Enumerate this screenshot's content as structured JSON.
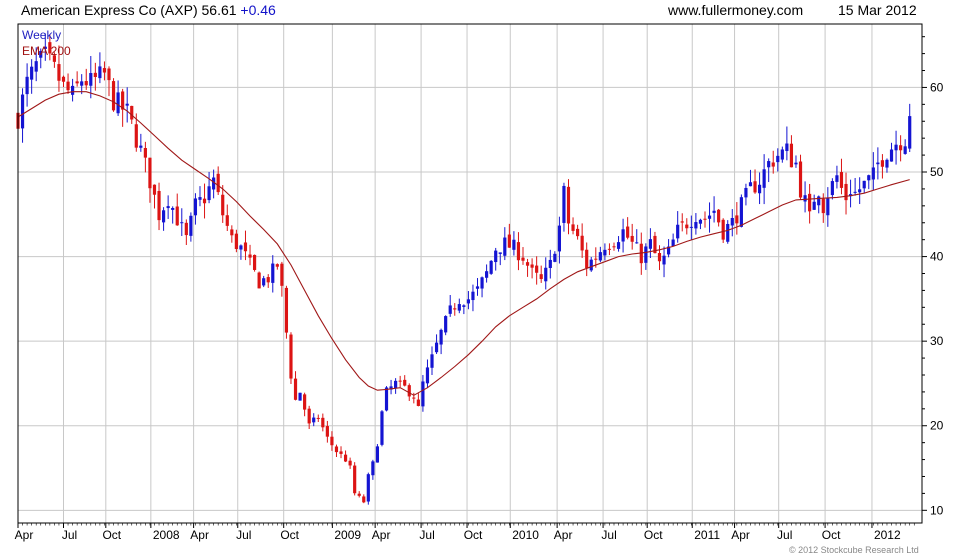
{
  "header": {
    "title": "American Express Co (AXP) 56.61",
    "change": "+0.46",
    "site": "www.fullermoney.com",
    "date": "15 Mar 2012"
  },
  "legend": {
    "weekly": "Weekly",
    "ema": "EMA 200"
  },
  "copyright": "© 2012 Stockcube Research Ltd",
  "colors": {
    "up": "#1414d2",
    "down": "#dc1414",
    "ema": "#a01818",
    "grid": "#c8c8c8",
    "axis": "#000000"
  },
  "chart_data": {
    "type": "candlestick",
    "ylim": [
      8.5,
      67.5
    ],
    "xlim": [
      0,
      198.7
    ],
    "y_ticks": [
      10,
      20,
      30,
      40,
      50,
      60
    ],
    "x_ticks": [
      {
        "label": "Apr",
        "x": 0
      },
      {
        "label": "Jul",
        "x": 10
      },
      {
        "label": "Oct",
        "x": 19.3
      },
      {
        "label": "2008",
        "x": 29.2
      },
      {
        "label": "Apr",
        "x": 38.6
      },
      {
        "label": "Jul",
        "x": 48.3
      },
      {
        "label": "Oct",
        "x": 58.4
      },
      {
        "label": "2009",
        "x": 69.1
      },
      {
        "label": "Apr",
        "x": 78.5
      },
      {
        "label": "Jul",
        "x": 88.6
      },
      {
        "label": "Oct",
        "x": 98.7
      },
      {
        "label": "2010",
        "x": 108.2
      },
      {
        "label": "Apr",
        "x": 118.5
      },
      {
        "label": "Jul",
        "x": 128.6
      },
      {
        "label": "Oct",
        "x": 138.3
      },
      {
        "label": "2011",
        "x": 148.2
      },
      {
        "label": "Apr",
        "x": 157.5
      },
      {
        "label": "Jul",
        "x": 167.2
      },
      {
        "label": "Oct",
        "x": 177.4
      },
      {
        "label": "2012",
        "x": 187.7
      }
    ],
    "close_anchors": [
      [
        0,
        56.5
      ],
      [
        2,
        60.5
      ],
      [
        4,
        62.5
      ],
      [
        6,
        63.5
      ],
      [
        8,
        62
      ],
      [
        10,
        60
      ],
      [
        12,
        59
      ],
      [
        14,
        61
      ],
      [
        16,
        60.5
      ],
      [
        19,
        61.5
      ],
      [
        21,
        58.5
      ],
      [
        24,
        57
      ],
      [
        27,
        52.5
      ],
      [
        29,
        49
      ],
      [
        31,
        45
      ],
      [
        33,
        47
      ],
      [
        35,
        44.5
      ],
      [
        37,
        42
      ],
      [
        39,
        46
      ],
      [
        41,
        47
      ],
      [
        43,
        49
      ],
      [
        45,
        45
      ],
      [
        47,
        42
      ],
      [
        49,
        41
      ],
      [
        51,
        39
      ],
      [
        53,
        37
      ],
      [
        55,
        37.5
      ],
      [
        57,
        39
      ],
      [
        58,
        36
      ],
      [
        59,
        31
      ],
      [
        60,
        26
      ],
      [
        61,
        23
      ],
      [
        62,
        24
      ],
      [
        64,
        20
      ],
      [
        66,
        21
      ],
      [
        68,
        18.5
      ],
      [
        70,
        17
      ],
      [
        72,
        16
      ],
      [
        73,
        15
      ],
      [
        74,
        12
      ],
      [
        75,
        11.5
      ],
      [
        76,
        11
      ],
      [
        77,
        14
      ],
      [
        78,
        15.5
      ],
      [
        79,
        18
      ],
      [
        80,
        21.5
      ],
      [
        81,
        24
      ],
      [
        83,
        25
      ],
      [
        85,
        24.5
      ],
      [
        87,
        23.5
      ],
      [
        88,
        22
      ],
      [
        89,
        25
      ],
      [
        91,
        28
      ],
      [
        93,
        31
      ],
      [
        95,
        33.5
      ],
      [
        97,
        35
      ],
      [
        99,
        35
      ],
      [
        101,
        36
      ],
      [
        103,
        38
      ],
      [
        105,
        41
      ],
      [
        107,
        41.5
      ],
      [
        109,
        41
      ],
      [
        111,
        40
      ],
      [
        113,
        38
      ],
      [
        115,
        37
      ],
      [
        117,
        39
      ],
      [
        119,
        43.5
      ],
      [
        120,
        47.5
      ],
      [
        121,
        44
      ],
      [
        123,
        42
      ],
      [
        125,
        39
      ],
      [
        127,
        40
      ],
      [
        129,
        41.5
      ],
      [
        131,
        42
      ],
      [
        133,
        43
      ],
      [
        135,
        41.5
      ],
      [
        137,
        40
      ],
      [
        139,
        41.5
      ],
      [
        141,
        39
      ],
      [
        143,
        40.5
      ],
      [
        145,
        43
      ],
      [
        147,
        44
      ],
      [
        149,
        45
      ],
      [
        151,
        44.5
      ],
      [
        153,
        45.5
      ],
      [
        155,
        43
      ],
      [
        157,
        44
      ],
      [
        159,
        46
      ],
      [
        161,
        48
      ],
      [
        163,
        49
      ],
      [
        165,
        51
      ],
      [
        167,
        52
      ],
      [
        169,
        52.5
      ],
      [
        170,
        51.5
      ],
      [
        171,
        51
      ],
      [
        172,
        48
      ],
      [
        173,
        46.5
      ],
      [
        174,
        44.5
      ],
      [
        175,
        47
      ],
      [
        176,
        48
      ],
      [
        177,
        46
      ],
      [
        178,
        47.5
      ],
      [
        179,
        48.5
      ],
      [
        180,
        49.5
      ],
      [
        181,
        48
      ],
      [
        182,
        47
      ],
      [
        183,
        48
      ],
      [
        184,
        47.5
      ],
      [
        185,
        48
      ],
      [
        186,
        48.5
      ],
      [
        187,
        49
      ],
      [
        188,
        49.5
      ],
      [
        189,
        51
      ],
      [
        191,
        52.5
      ],
      [
        193,
        53.5
      ],
      [
        195,
        54
      ],
      [
        196,
        56.61
      ]
    ],
    "ema_200": [
      [
        0,
        56.5
      ],
      [
        3,
        57.5
      ],
      [
        6,
        58.5
      ],
      [
        9,
        59.2
      ],
      [
        12,
        59.5
      ],
      [
        15,
        59.5
      ],
      [
        18,
        59
      ],
      [
        21,
        58.3
      ],
      [
        24,
        57.2
      ],
      [
        27,
        55.8
      ],
      [
        30,
        54.3
      ],
      [
        33,
        52.8
      ],
      [
        36,
        51.4
      ],
      [
        39,
        50.3
      ],
      [
        42,
        49.2
      ],
      [
        45,
        48
      ],
      [
        48,
        46.5
      ],
      [
        51,
        44.8
      ],
      [
        54,
        43.2
      ],
      [
        57,
        41.5
      ],
      [
        60,
        39
      ],
      [
        63,
        36
      ],
      [
        66,
        33
      ],
      [
        69,
        30.3
      ],
      [
        72,
        27.8
      ],
      [
        75,
        25.7
      ],
      [
        77,
        24.7
      ],
      [
        79,
        24.2
      ],
      [
        81,
        24.3
      ],
      [
        84,
        24.5
      ],
      [
        87,
        23.6
      ],
      [
        90,
        24.5
      ],
      [
        93,
        25.7
      ],
      [
        96,
        27
      ],
      [
        99,
        28.4
      ],
      [
        102,
        30
      ],
      [
        105,
        31.7
      ],
      [
        108,
        33
      ],
      [
        111,
        34
      ],
      [
        114,
        35
      ],
      [
        117,
        36.2
      ],
      [
        120,
        37.3
      ],
      [
        123,
        38.2
      ],
      [
        126,
        38.8
      ],
      [
        129,
        39.4
      ],
      [
        132,
        40
      ],
      [
        135,
        40.3
      ],
      [
        138,
        40.5
      ],
      [
        141,
        40.8
      ],
      [
        144,
        41.2
      ],
      [
        147,
        41.8
      ],
      [
        150,
        42.3
      ],
      [
        153,
        42.7
      ],
      [
        156,
        43.1
      ],
      [
        159,
        43.7
      ],
      [
        162,
        44.5
      ],
      [
        165,
        45.3
      ],
      [
        168,
        46.1
      ],
      [
        171,
        46.7
      ],
      [
        174,
        46.8
      ],
      [
        177,
        46.9
      ],
      [
        180,
        47
      ],
      [
        183,
        47.2
      ],
      [
        186,
        47.5
      ],
      [
        189,
        48
      ],
      [
        192,
        48.5
      ],
      [
        196,
        49.1
      ]
    ]
  }
}
